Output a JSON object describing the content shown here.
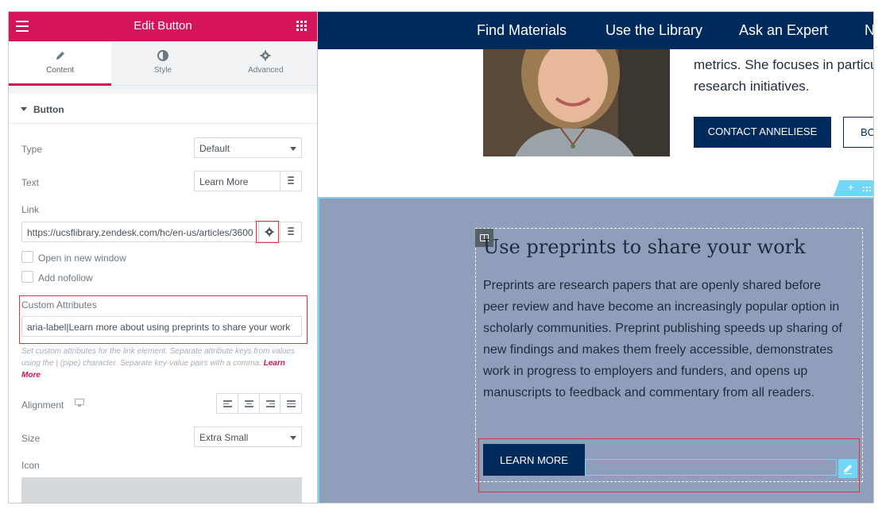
{
  "panel": {
    "title": "Edit Button",
    "tabs": [
      {
        "label": "Content",
        "icon": "pencil-icon",
        "active": true
      },
      {
        "label": "Style",
        "icon": "contrast-icon",
        "active": false
      },
      {
        "label": "Advanced",
        "icon": "gear-icon",
        "active": false
      }
    ],
    "section_title": "Button",
    "type": {
      "label": "Type",
      "value": "Default"
    },
    "text": {
      "label": "Text",
      "value": "Learn More"
    },
    "link": {
      "label": "Link",
      "value": "https://ucsflibrary.zendesk.com/hc/en-us/articles/3600"
    },
    "open_new_window": {
      "label": "Open in new window",
      "checked": false
    },
    "add_nofollow": {
      "label": "Add nofollow",
      "checked": false
    },
    "custom_attributes": {
      "label": "Custom Attributes",
      "value": "aria-label|Learn more about using preprints to share your work"
    },
    "help_text": "Set custom attributes for the link element. Separate attribute keys from values using the | (pipe) character. Separate key-value pairs with a comma.",
    "help_link": "Learn More",
    "alignment": {
      "label": "Alignment"
    },
    "size": {
      "label": "Size",
      "value": "Extra Small"
    },
    "icon_label": "Icon"
  },
  "preview": {
    "nav": [
      "Find Materials",
      "Use the Library",
      "Ask an Expert",
      "N"
    ],
    "bio_lines": [
      "metrics. She focuses in particu",
      "research initiatives."
    ],
    "contact_button": "CONTACT ANNELIESE",
    "outline_button": "BO",
    "heading": "Use preprints to share your work",
    "paragraph": "Preprints are research papers that are openly shared before peer review and have become an increasingly popular option in scholarly communities. Preprint publishing speeds up sharing of new findings and makes them freely accessible, demonstrates work in progress to employers and funders, and opens up manuscripts to feedback and commentary from all readers.",
    "learn_button": "LEARN MORE",
    "plus_symbol": "+"
  },
  "colors": {
    "panel_accent": "#d5145a",
    "nav_bg": "#002a5c",
    "section_bg": "#8f9fbb",
    "editor_highlight": "#71d7f7",
    "annotation_red": "#e0333b"
  }
}
